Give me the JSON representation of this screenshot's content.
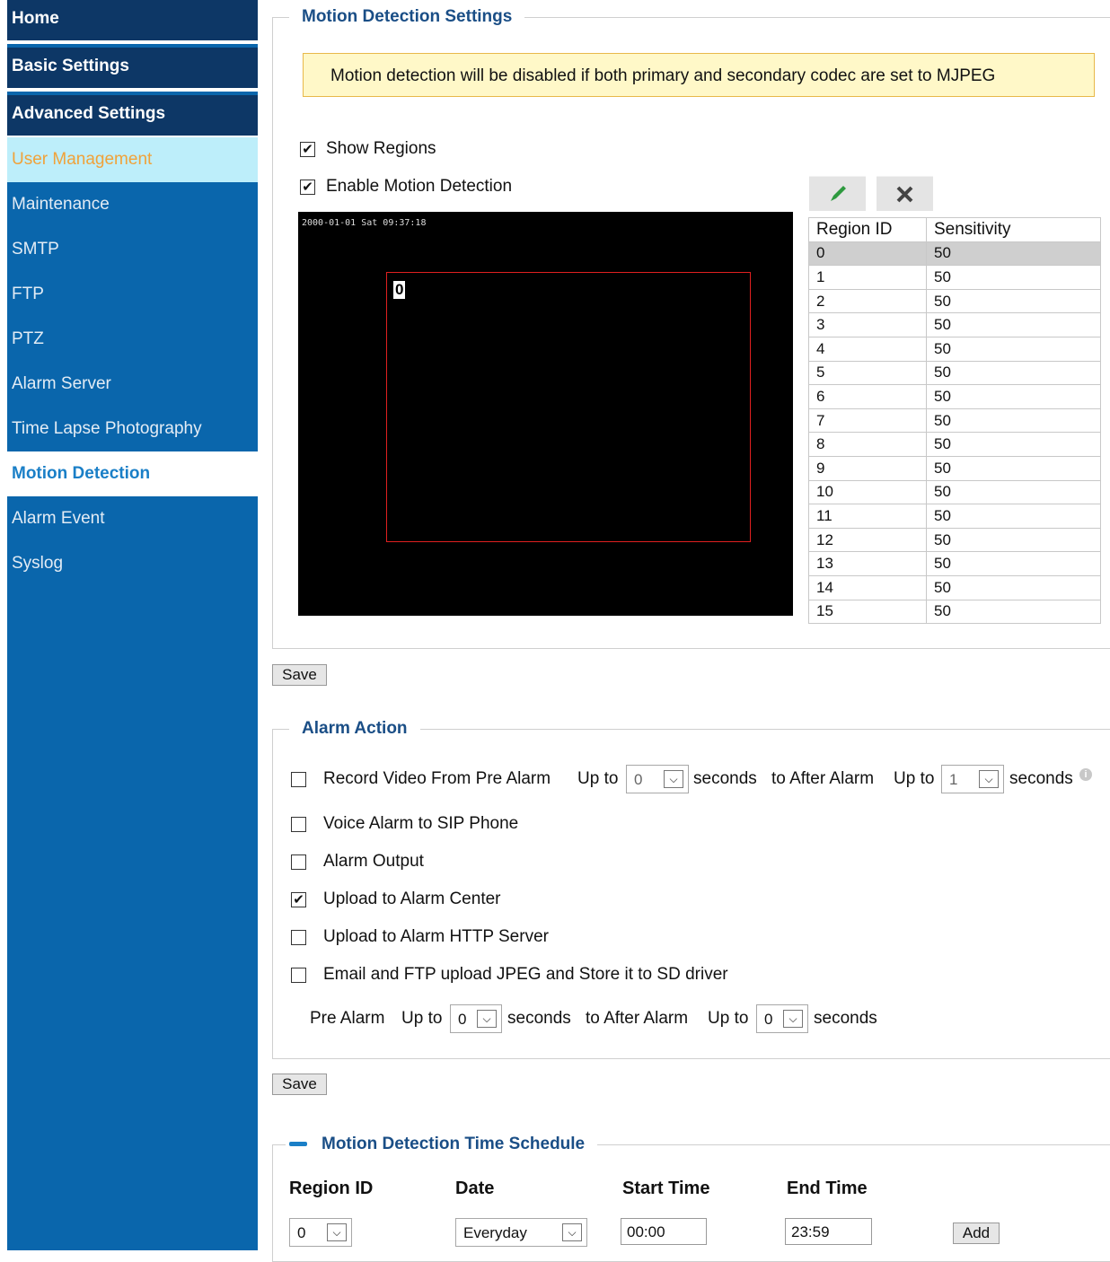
{
  "nav": {
    "home": "Home",
    "basic_settings": "Basic Settings",
    "advanced_settings": "Advanced Settings",
    "items": [
      "User Management",
      "Maintenance",
      "SMTP",
      "FTP",
      "PTZ",
      "Alarm Server",
      "Time Lapse Photography",
      "Motion Detection",
      "Alarm Event",
      "Syslog"
    ]
  },
  "motion": {
    "legend": "Motion Detection Settings",
    "notice": "Motion detection will be disabled if both primary and secondary codec are set to MJPEG",
    "show_regions": "Show Regions",
    "enable_motion": "Enable Motion Detection",
    "timestamp": "2000-01-01 Sat 09:37:18",
    "region_label": "0",
    "table_headers": [
      "Region ID",
      "Sensitivity"
    ],
    "regions": [
      [
        "0",
        "50"
      ],
      [
        "1",
        "50"
      ],
      [
        "2",
        "50"
      ],
      [
        "3",
        "50"
      ],
      [
        "4",
        "50"
      ],
      [
        "5",
        "50"
      ],
      [
        "6",
        "50"
      ],
      [
        "7",
        "50"
      ],
      [
        "8",
        "50"
      ],
      [
        "9",
        "50"
      ],
      [
        "10",
        "50"
      ],
      [
        "11",
        "50"
      ],
      [
        "12",
        "50"
      ],
      [
        "13",
        "50"
      ],
      [
        "14",
        "50"
      ],
      [
        "15",
        "50"
      ]
    ],
    "edit_icon": "pencil-icon",
    "delete_icon": "close-icon"
  },
  "save_label": "Save",
  "alarm": {
    "legend": "Alarm Action",
    "record": "Record Video From Pre Alarm",
    "up_to": "Up to",
    "seconds": "seconds",
    "to_after_alarm": "to After Alarm",
    "pre_value": "0",
    "after_value": "1",
    "voice": "Voice Alarm to SIP Phone",
    "output": "Alarm Output",
    "upload_center": "Upload to Alarm Center",
    "upload_http": "Upload to Alarm HTTP Server",
    "email_ftp": "Email and FTP upload JPEG and Store it to SD driver",
    "pre_alarm": "Pre Alarm",
    "pre2_value": "0",
    "after2_value": "0"
  },
  "schedule": {
    "legend": "Motion Detection Time Schedule",
    "col_region": "Region ID",
    "col_date": "Date",
    "col_start": "Start Time",
    "col_end": "End Time",
    "region_value": "0",
    "date_value": "Everyday",
    "start_value": "00:00",
    "end_value": "23:59",
    "add_label": "Add"
  },
  "checks": {
    "show_regions": true,
    "enable_motion": true,
    "record": false,
    "voice": false,
    "output": false,
    "upload_center": true,
    "upload_http": false,
    "email_ftp": false
  }
}
